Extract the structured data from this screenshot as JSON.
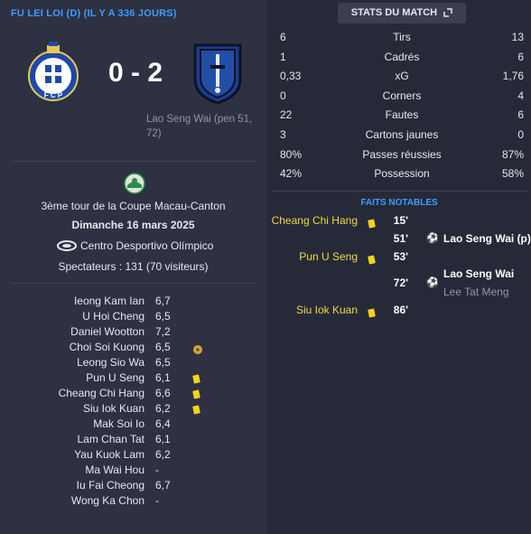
{
  "match": {
    "title": "FU LEI LOI (D) (IL Y A 336 JOURS)",
    "score": "0 - 2",
    "scorers": "Lao Seng Wai (pen 51, 72)",
    "home_badge_text": "F C P",
    "competition": "3ème tour de la Coupe Macau-Canton",
    "date": "Dimanche 16 mars 2025",
    "stadium": "Centro Desportivo Olímpico",
    "spectators": "Spectateurs : 131 (70 visiteurs)"
  },
  "players": [
    {
      "name": "Ieong Kam Ian",
      "rating": "6,7",
      "event": ""
    },
    {
      "name": "U Hoi Cheng",
      "rating": "6,5",
      "event": ""
    },
    {
      "name": "Daniel Wootton",
      "rating": "7,2",
      "event": ""
    },
    {
      "name": "Choi Soi Kuong",
      "rating": "6,5",
      "event": "sub"
    },
    {
      "name": "Leong Sio Wa",
      "rating": "6,5",
      "event": ""
    },
    {
      "name": "Pun U Seng",
      "rating": "6,1",
      "event": "yellow"
    },
    {
      "name": "Cheang Chi Hang",
      "rating": "6,6",
      "event": "yellow"
    },
    {
      "name": "Siu Iok Kuan",
      "rating": "6,2",
      "event": "yellow"
    },
    {
      "name": "Mak Soi Io",
      "rating": "6,4",
      "event": ""
    },
    {
      "name": "Lam Chan Tat",
      "rating": "6,1",
      "event": ""
    },
    {
      "name": "Yau Kuok Lam",
      "rating": "6,2",
      "event": ""
    },
    {
      "name": "Ma Wai Hou",
      "rating": "-",
      "event": ""
    },
    {
      "name": "Iu Fai Cheong",
      "rating": "6,7",
      "event": ""
    },
    {
      "name": "Wong Ka Chon",
      "rating": "-",
      "event": ""
    }
  ],
  "stats_button": "STATS DU MATCH",
  "stats": [
    {
      "home": "6",
      "label": "Tirs",
      "away": "13"
    },
    {
      "home": "1",
      "label": "Cadrés",
      "away": "6"
    },
    {
      "home": "0,33",
      "label": "xG",
      "away": "1,76"
    },
    {
      "home": "0",
      "label": "Corners",
      "away": "4"
    },
    {
      "home": "22",
      "label": "Fautes",
      "away": "6"
    },
    {
      "home": "3",
      "label": "Cartons jaunes",
      "away": "0"
    },
    {
      "home": "80%",
      "label": "Passes réussies",
      "away": "87%"
    },
    {
      "home": "42%",
      "label": "Possession",
      "away": "58%"
    }
  ],
  "faits_title": "FAITS NOTABLES",
  "events": [
    {
      "minute": "15'",
      "home_player": "Cheang Chi Hang",
      "type": "yellow"
    },
    {
      "minute": "51'",
      "away_player": "Lao Seng Wai (p)",
      "type": "goal"
    },
    {
      "minute": "53'",
      "home_player": "Pun U Seng",
      "type": "yellow"
    },
    {
      "minute": "72'",
      "away_player": "Lao Seng Wai",
      "assist": "Lee Tat Meng",
      "type": "goal"
    },
    {
      "minute": "86'",
      "home_player": "Siu Iok Kuan",
      "type": "yellow"
    }
  ],
  "colors": {
    "accent": "#3f9bff",
    "yellow_card": "#f4d518",
    "home_badge_blue": "#1c4aa8",
    "away_badge_blue": "#1b3d8f"
  }
}
